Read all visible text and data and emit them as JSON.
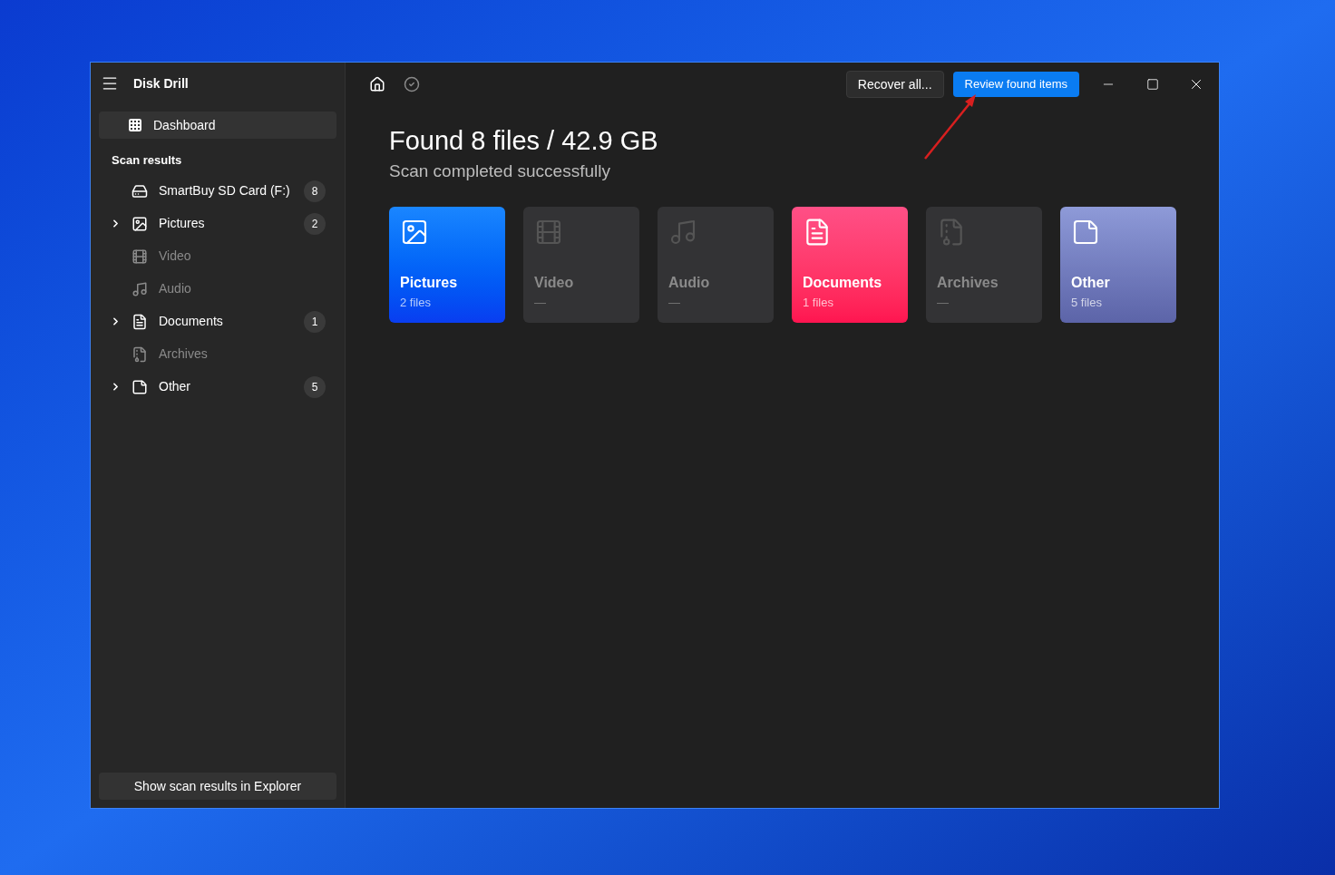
{
  "window": {
    "title": "Disk Drill"
  },
  "sidebar": {
    "dashboard": {
      "label": "Dashboard",
      "selected": true
    },
    "section_title": "Scan results",
    "items": [
      {
        "kind": "drive",
        "label": "SmartBuy SD Card (F:)",
        "count": "8",
        "expandable": false,
        "disabled": false
      },
      {
        "kind": "pictures",
        "label": "Pictures",
        "count": "2",
        "expandable": true,
        "disabled": false
      },
      {
        "kind": "video",
        "label": "Video",
        "expandable": false,
        "disabled": true
      },
      {
        "kind": "audio",
        "label": "Audio",
        "expandable": false,
        "disabled": true
      },
      {
        "kind": "documents",
        "label": "Documents",
        "count": "1",
        "expandable": true,
        "disabled": false
      },
      {
        "kind": "archives",
        "label": "Archives",
        "expandable": false,
        "disabled": true
      },
      {
        "kind": "other",
        "label": "Other",
        "count": "5",
        "expandable": true,
        "disabled": false
      }
    ],
    "footer_button": "Show scan results in Explorer"
  },
  "toolbar": {
    "recover_button": "Recover all...",
    "review_button": "Review found items"
  },
  "heading": "Found 8 files / 42.9 GB",
  "subheading": "Scan completed successfully",
  "cards": [
    {
      "kind": "pictures",
      "label": "Pictures",
      "detail": "2 files",
      "disabled": false
    },
    {
      "kind": "video",
      "label": "Video",
      "detail": "—",
      "disabled": true
    },
    {
      "kind": "audio",
      "label": "Audio",
      "detail": "—",
      "disabled": true
    },
    {
      "kind": "documents",
      "label": "Documents",
      "detail": "1 files",
      "disabled": false
    },
    {
      "kind": "archives",
      "label": "Archives",
      "detail": "—",
      "disabled": true
    },
    {
      "kind": "other",
      "label": "Other",
      "detail": "5 files",
      "disabled": false
    }
  ]
}
